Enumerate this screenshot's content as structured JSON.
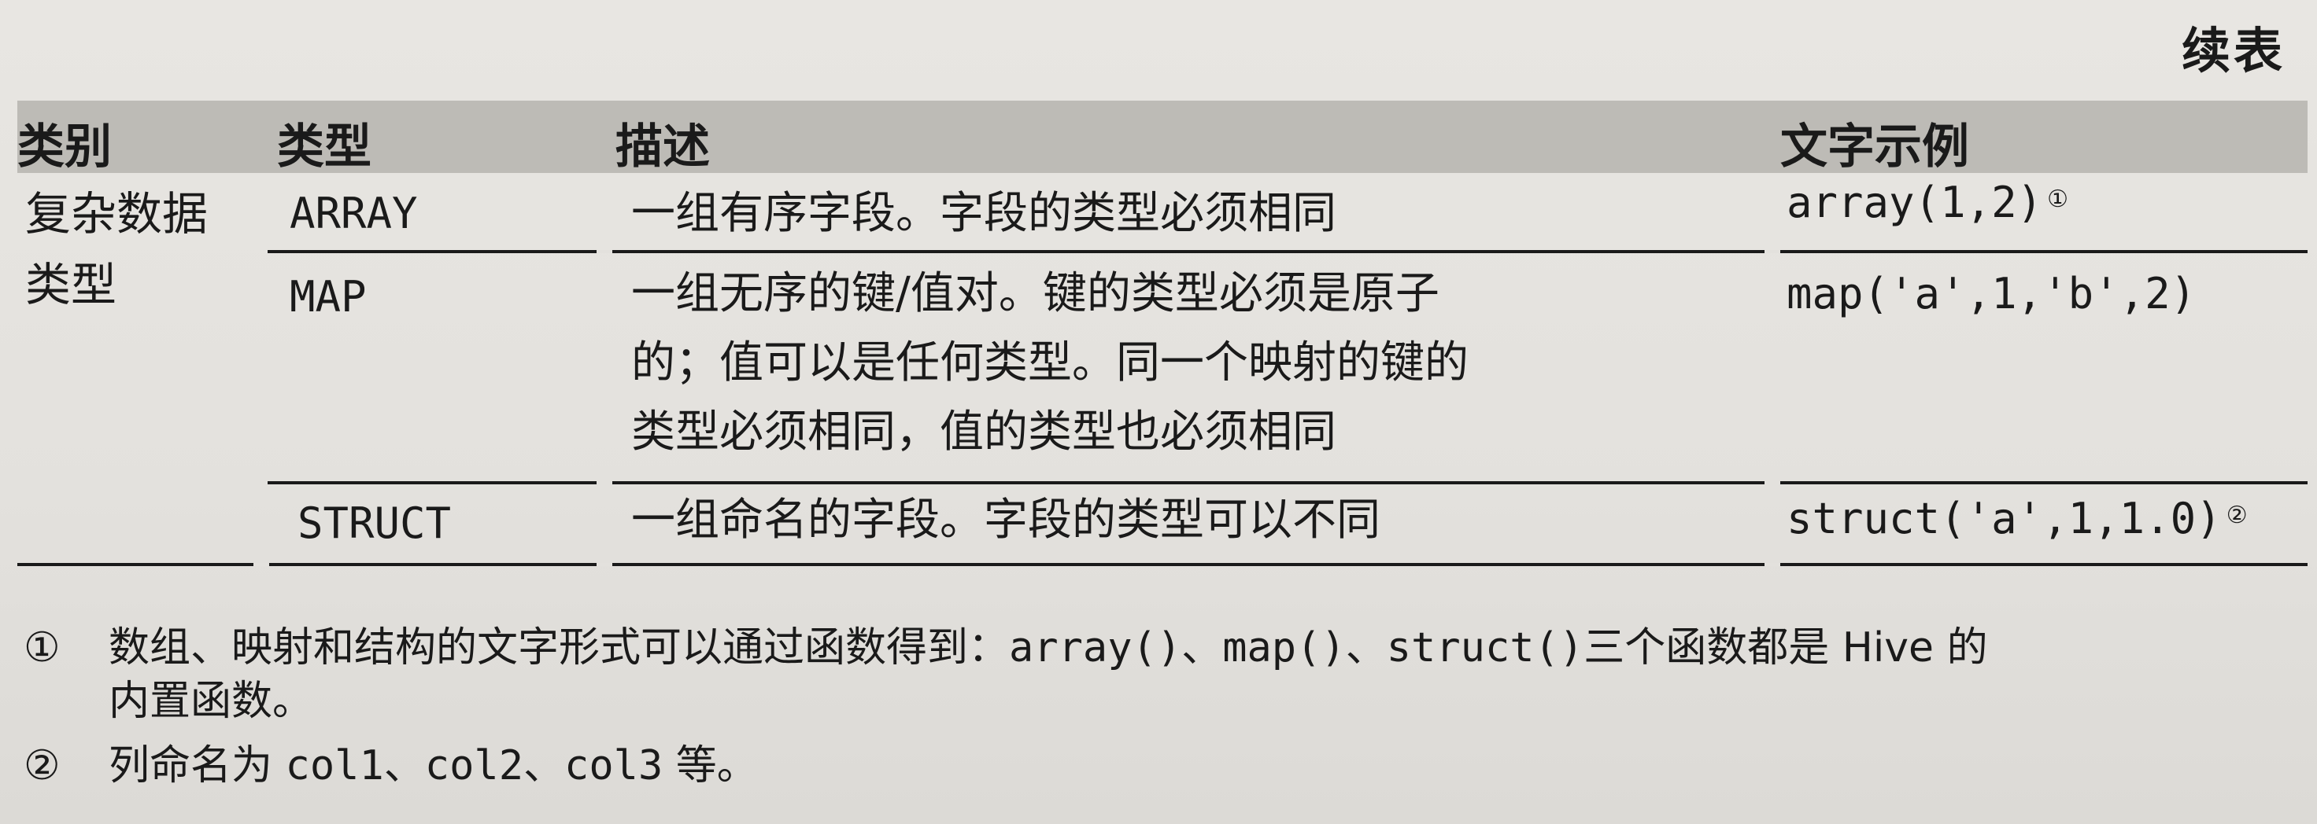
{
  "page_title": "续表",
  "table": {
    "headers": {
      "category": "类别",
      "type": "类型",
      "description": "描述",
      "example": "文字示例"
    },
    "category_label": [
      "复杂数据",
      "类型"
    ],
    "rows": [
      {
        "type": "ARRAY",
        "description": [
          "一组有序字段。字段的类型必须相同"
        ],
        "example": "array(1,2)",
        "note": "①"
      },
      {
        "type": "MAP",
        "description": [
          "一组无序的键/值对。键的类型必须是原子",
          "的；值可以是任何类型。同一个映射的键的",
          "类型必须相同，值的类型也必须相同"
        ],
        "example": "map('a',1,'b',2)",
        "note": ""
      },
      {
        "type": "STRUCT",
        "description": [
          "一组命名的字段。字段的类型可以不同"
        ],
        "example": "struct('a',1,1.0)",
        "note": "②"
      }
    ]
  },
  "footnotes": [
    {
      "mark": "①",
      "parts": [
        "数组、映射和结构的文字形式可以通过函数得到：",
        "array()",
        "、",
        "map()",
        "、",
        "struct()",
        "三个函数都是 Hive 的"
      ],
      "continuation": "内置函数。"
    },
    {
      "mark": "②",
      "parts": [
        "列命名为 ",
        "col1",
        "、",
        "col2",
        "、",
        "col3",
        " 等。"
      ]
    }
  ]
}
